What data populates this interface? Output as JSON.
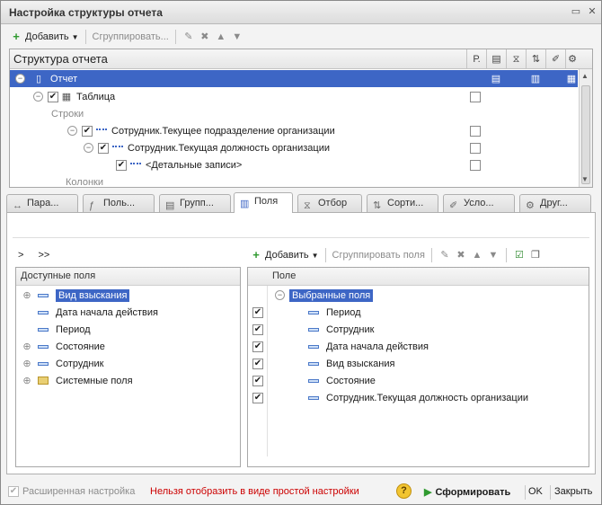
{
  "window": {
    "title": "Настройка структуры отчета"
  },
  "top_toolbar": {
    "add_label": "Добавить",
    "group_label": "Сгруппировать..."
  },
  "structure": {
    "header": "Структура отчета",
    "col_r": "Р.",
    "rows": [
      {
        "label": "Отчет",
        "selected": true
      },
      {
        "label": "Таблица",
        "checked": true
      },
      {
        "label": "Строки"
      },
      {
        "label": "Сотрудник.Текущее подразделение организации",
        "checked": true
      },
      {
        "label": "Сотрудник.Текущая должность организации",
        "checked": true
      },
      {
        "label": "<Детальные записи>",
        "checked": true
      },
      {
        "label": "Колонки"
      }
    ]
  },
  "tabs": [
    "Пара...",
    "Поль...",
    "Групп...",
    "Поля",
    "Отбор",
    "Сорти...",
    "Усло...",
    "Друг..."
  ],
  "active_tab": "Поля",
  "left_pane": {
    "nav_right": ">",
    "nav_right_all": ">>",
    "header": "Доступные поля",
    "items": [
      "Вид взыскания",
      "Дата начала действия",
      "Период",
      "Состояние",
      "Сотрудник",
      "Системные поля"
    ]
  },
  "right_pane": {
    "add_label": "Добавить",
    "group_label": "Сгруппировать поля",
    "header": "Поле",
    "group_title": "Выбранные поля",
    "items": [
      "Период",
      "Сотрудник",
      "Дата начала действия",
      "Вид взыскания",
      "Состояние",
      "Сотрудник.Текущая должность организации"
    ]
  },
  "footer": {
    "advanced_label": "Расширенная настройка",
    "warning": "Нельзя отобразить в виде простой настройки",
    "help": "?",
    "generate_label": "Сформировать",
    "ok_label": "OK",
    "close_label": "Закрыть"
  },
  "colors": {
    "selection": "#3d66c5",
    "warning": "#cc0000"
  }
}
